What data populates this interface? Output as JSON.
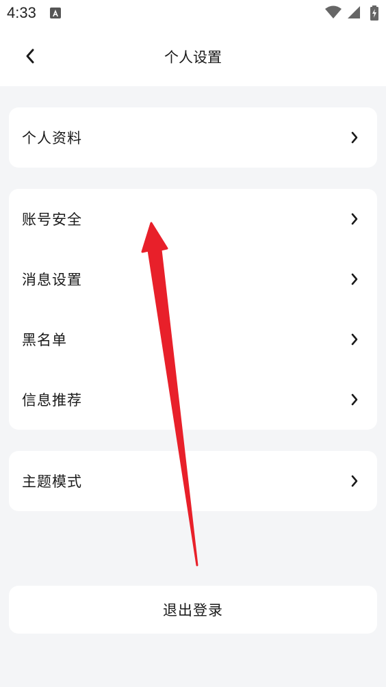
{
  "status_bar": {
    "time": "4:33",
    "notification_icon": "a-notification-icon",
    "wifi_icon": "wifi-icon",
    "signal_icon": "signal-icon",
    "battery_icon": "battery-charging-icon"
  },
  "header": {
    "title": "个人设置",
    "back_icon": "chevron-left-icon"
  },
  "sections": {
    "profile": {
      "label": "个人资料"
    },
    "group": {
      "items": [
        {
          "label": "账号安全"
        },
        {
          "label": "消息设置"
        },
        {
          "label": "黑名单"
        },
        {
          "label": "信息推荐"
        }
      ]
    },
    "theme": {
      "label": "主题模式"
    }
  },
  "logout": {
    "label": "退出登录"
  },
  "colors": {
    "background": "#f4f5f7",
    "card": "#ffffff",
    "text": "#1a1a1a",
    "annotation_arrow": "#e8202a"
  }
}
